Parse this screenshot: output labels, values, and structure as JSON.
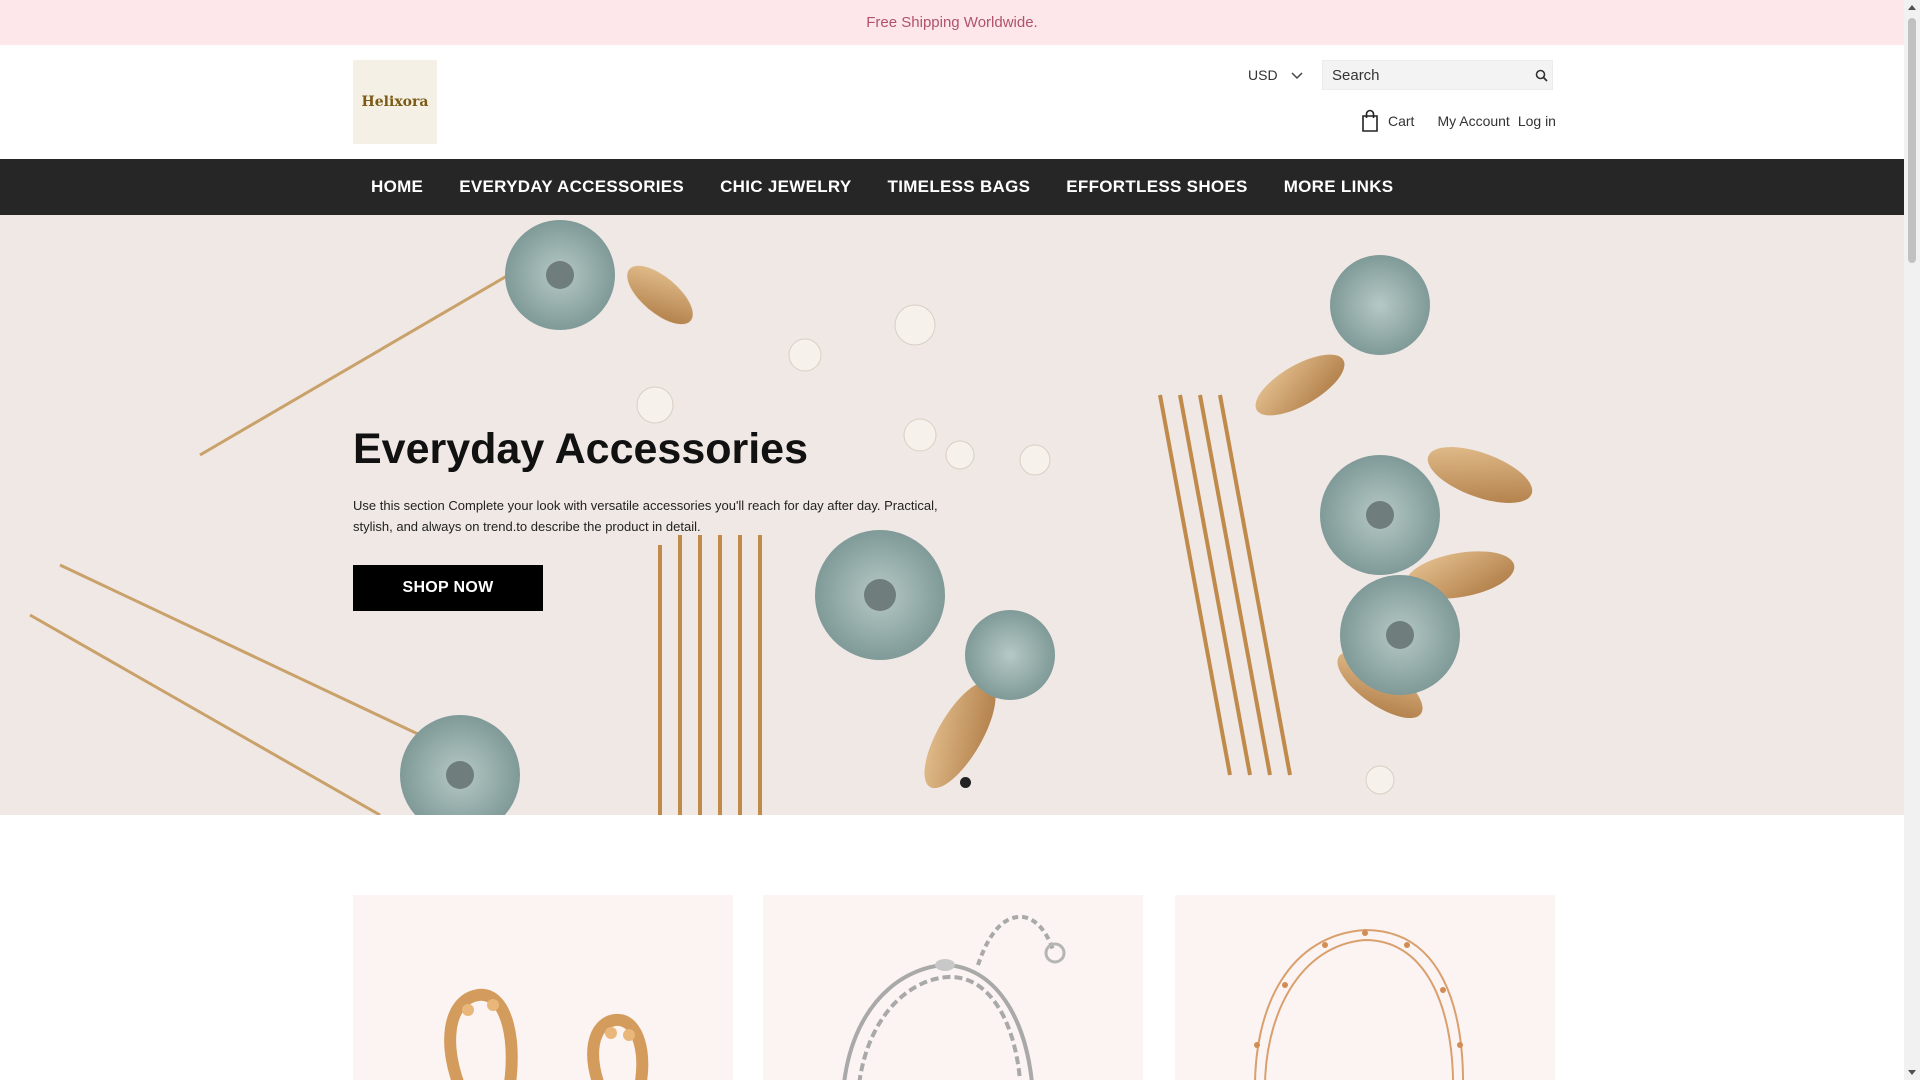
{
  "announcement": {
    "text": "Free Shipping Worldwide."
  },
  "header": {
    "logo_text": "Helixora",
    "currency": "USD",
    "search_placeholder": "Search",
    "cart_label": "Cart",
    "my_account_label": "My Account",
    "login_label": "Log in"
  },
  "nav": {
    "items": [
      {
        "label": "HOME"
      },
      {
        "label": "EVERYDAY ACCESSORIES"
      },
      {
        "label": "CHIC JEWELRY"
      },
      {
        "label": "TIMELESS BAGS"
      },
      {
        "label": "EFFORTLESS SHOES"
      },
      {
        "label": "MORE LINKS"
      }
    ]
  },
  "hero": {
    "title": "Everyday Accessories",
    "description": "Use this section Complete your look with versatile accessories you'll reach for day after day. Practical, stylish, and always on trend.to describe the product in detail.",
    "button_label": "SHOP NOW",
    "slide_count": 1,
    "active_slide": 1
  },
  "products": {
    "cards": [
      {
        "image": "gold-hoop-earrings-image"
      },
      {
        "image": "silver-chain-bracelet-image"
      },
      {
        "image": "gold-bead-bracelet-image"
      }
    ]
  },
  "colors": {
    "announcement_bg": "#fde7ea",
    "announcement_text": "#b0536a",
    "nav_bg": "#262626",
    "button_bg": "#000000",
    "card_bg": "#fcf4f3"
  }
}
